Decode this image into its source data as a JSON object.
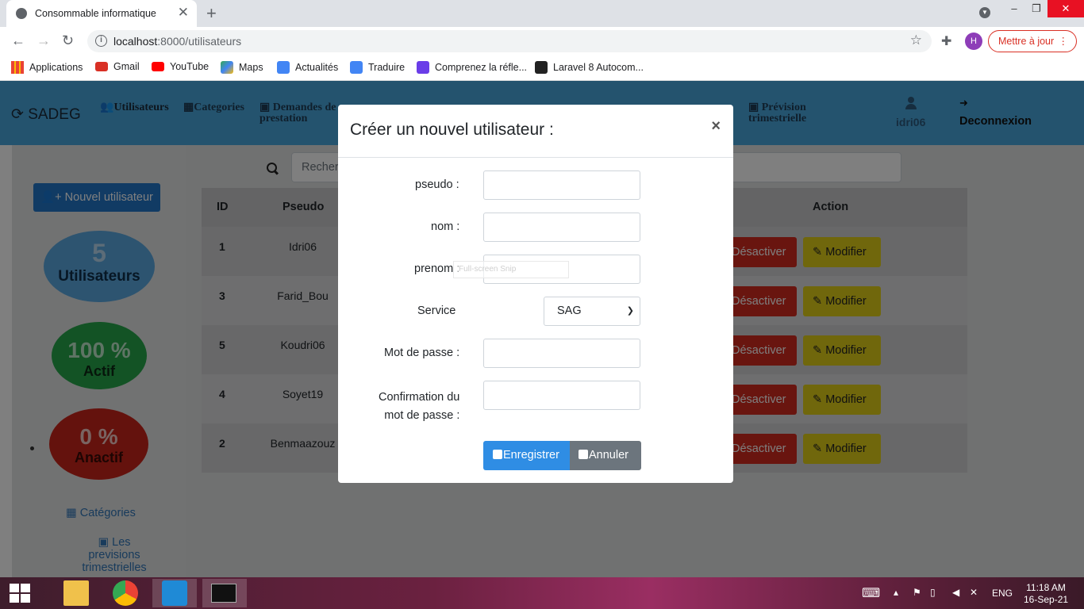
{
  "browser": {
    "tab_title": "Consommable informatique",
    "tab_close": "✕",
    "new_tab": "+",
    "window_controls": [
      "–",
      "❐",
      "✕"
    ],
    "url_host": "localhost",
    "url_rest": ":8000/utilisateurs",
    "avatar_letter": "H",
    "update_button": "Mettre à jour",
    "bookmarks": [
      {
        "label": "Applications",
        "icon": "apps-grid-icon",
        "color": "#ea4335"
      },
      {
        "label": "Gmail",
        "icon": "gmail-icon",
        "color": "#d93025"
      },
      {
        "label": "YouTube",
        "icon": "youtube-icon",
        "color": "#ff0000"
      },
      {
        "label": "Maps",
        "icon": "maps-icon",
        "color": "#34a853"
      },
      {
        "label": "Actualités",
        "icon": "news-icon",
        "color": "#4285f4"
      },
      {
        "label": "Traduire",
        "icon": "translate-icon",
        "color": "#4285f4"
      },
      {
        "label": "Comprenez la réfle...",
        "icon": "bookmark-icon",
        "color": "#6a3de8"
      },
      {
        "label": "Laravel 8 Autocom...",
        "icon": "bookmark-icon",
        "color": "#222222"
      }
    ]
  },
  "header": {
    "brand": "SADEG",
    "nav": [
      {
        "label": "Utilisateurs",
        "color": "#1a2b3a"
      },
      {
        "label": "Categories"
      },
      {
        "label_line1": "Demandes de",
        "label_line2": "prestation"
      },
      {
        "label_line1": "Prévision",
        "label_line2": "trimestrielle"
      }
    ],
    "username": "idri06",
    "logout": "Deconnexion"
  },
  "sidebar": {
    "new_user_button": "Nouvel utilisateur",
    "stats": [
      {
        "value": "5",
        "label": "Utilisateurs",
        "color": "#5aa8e0"
      },
      {
        "value": "100 %",
        "label": "Actif",
        "color": "#26a64b"
      },
      {
        "value": "0 %",
        "label": "Anactif",
        "color": "#c8241a"
      }
    ],
    "links": [
      {
        "label": "Catégories"
      },
      {
        "label_line1": "Les previsions",
        "label_line2": "trimestrielles"
      }
    ]
  },
  "search": {
    "placeholder": "Recher"
  },
  "table": {
    "headers": {
      "id": "ID",
      "pseudo": "Pseudo",
      "action": "Action"
    },
    "rows": [
      {
        "id": "1",
        "pseudo": "Idri06"
      },
      {
        "id": "3",
        "pseudo": "Farid_Bou"
      },
      {
        "id": "5",
        "pseudo": "Koudri06"
      },
      {
        "id": "4",
        "pseudo": "Soyet19"
      },
      {
        "id": "2",
        "pseudo": "Benmaazouz"
      }
    ],
    "deactivate_label": "Désactiver",
    "modify_label": "Modifier"
  },
  "modal": {
    "title": "Créer un nouvel utilisateur :",
    "close": "×",
    "fields": {
      "pseudo": "pseudo :",
      "nom": "nom :",
      "prenom": "prenom :",
      "service": "Service",
      "password": "Mot de passe :",
      "confirm_line1": "Confirmation du",
      "confirm_line2": "mot de passe :"
    },
    "service_value": "SAG",
    "snip_tooltip": "Full-screen Snip",
    "save": "Enregistrer",
    "cancel": "Annuler"
  },
  "taskbar": {
    "lang": "ENG",
    "time": "11:18 AM",
    "date": "16-Sep-21"
  }
}
